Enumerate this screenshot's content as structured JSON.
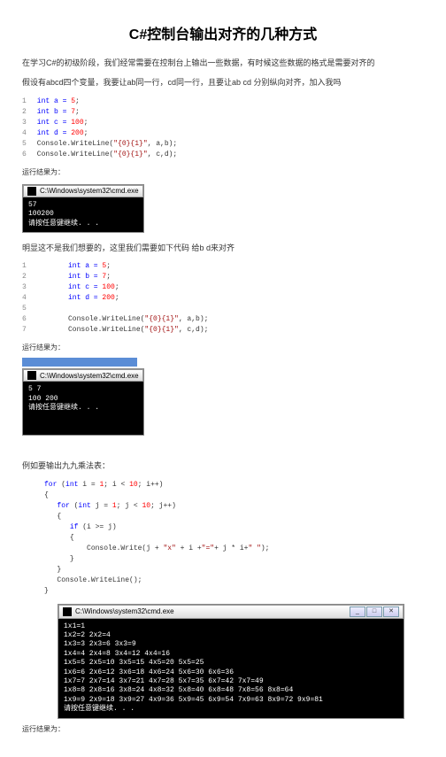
{
  "title": "C#控制台输出对齐的几种方式",
  "p1": "在学习C#的初级阶段，我们经常需要在控制台上输出一些数据，有时候这些数据的格式是需要对齐的",
  "p2": "假设有abcd四个变量，我要让ab同一行，cd同一行，且要让ab cd 分别纵向对齐，加入我吗",
  "code1": {
    "l1a": "1",
    "l1b": " int a = ",
    "l1c": "5",
    "l1d": ";",
    "l2a": "2",
    "l2b": " int b = ",
    "l2c": "7",
    "l2d": ";",
    "l3a": "3",
    "l3b": " int c = ",
    "l3c": "100",
    "l3d": ";",
    "l4a": "4",
    "l4b": " int d = ",
    "l4c": "200",
    "l4d": ";",
    "l5a": "5",
    "l5b": " Console.WriteLine(",
    "l5c": "\"{0}{1}\"",
    "l5d": ", a,b);",
    "l6a": "6",
    "l6b": " Console.WriteLine(",
    "l6c": "\"{0}{1}\"",
    "l6d": ", c,d);"
  },
  "result_label": "运行结果为：",
  "cmd_title": "C:\\Windows\\system32\\cmd.exe",
  "out1": {
    "l1": "57",
    "l2": "100200",
    "l3": "请按任意键继续. . ."
  },
  "p3": "明显这不是我们想要的，这里我们需要如下代码 给b d来对齐",
  "code2": {
    "l1a": "1",
    "l1b": "int a = ",
    "l1c": "5",
    "l1d": ";",
    "l2a": "2",
    "l2b": "int b = ",
    "l2c": "7",
    "l2d": ";",
    "l3a": "3",
    "l3b": "int c = ",
    "l3c": "100",
    "l3d": ";",
    "l4a": "4",
    "l4b": "int d = ",
    "l4c": "200",
    "l4d": ";",
    "l5a": "5",
    "l6a": "6",
    "l6b": "Console.WriteLine(",
    "l6c": "\"{0}{1}\"",
    "l6d": ", a,b);",
    "l7a": "7",
    "l7b": "Console.WriteLine(",
    "l7c": "\"{0}{1}\"",
    "l7d": ", c,d);"
  },
  "out2": {
    "l1": "5  7",
    "l2": "100  200",
    "l3": "请按任意键继续. . ."
  },
  "p4": "例如要输出九九乘法表：",
  "code3": {
    "l1a": "for",
    "l1b": " (",
    "l1c": "int",
    "l1d": " i = ",
    "l1e": "1",
    "l1f": "; i < ",
    "l1g": "10",
    "l1h": "; i++)",
    "l2": "{",
    "l3a": "for",
    "l3b": " (",
    "l3c": "int",
    "l3d": " j = ",
    "l3e": "1",
    "l3f": "; j < ",
    "l3g": "10",
    "l3h": "; j++)",
    "l4": "{",
    "l5a": "if",
    "l5b": " (i >= j)",
    "l6": "{",
    "l7a": "Console.Write(j + ",
    "l7b": "\"x\"",
    "l7c": " + i +",
    "l7d": "\"=\"",
    "l7e": "+ j * i+",
    "l7f": "\" \"",
    "l7g": ");",
    "l8": "}",
    "l9": "}",
    "l10": "Console.WriteLine();",
    "l11": "}"
  },
  "out3": {
    "l1": "1x1=1",
    "l2": "1x2=2  2x2=4",
    "l3": "1x3=3  2x3=6  3x3=9",
    "l4": "1x4=4  2x4=8  3x4=12  4x4=16",
    "l5": "1x5=5  2x5=10  3x5=15  4x5=20  5x5=25",
    "l6": "1x6=6  2x6=12  3x6=18  4x6=24  5x6=30  6x6=36",
    "l7": "1x7=7  2x7=14  3x7=21  4x7=28  5x7=35  6x7=42  7x7=49",
    "l8": "1x8=8  2x8=16  3x8=24  4x8=32  5x8=40  6x8=48  7x8=56  8x8=64",
    "l9": "1x9=9  2x9=18  3x9=27  4x9=36  5x9=45  6x9=54  7x9=63  8x9=72  9x9=81",
    "l10": "请按任意键继续. . ."
  }
}
